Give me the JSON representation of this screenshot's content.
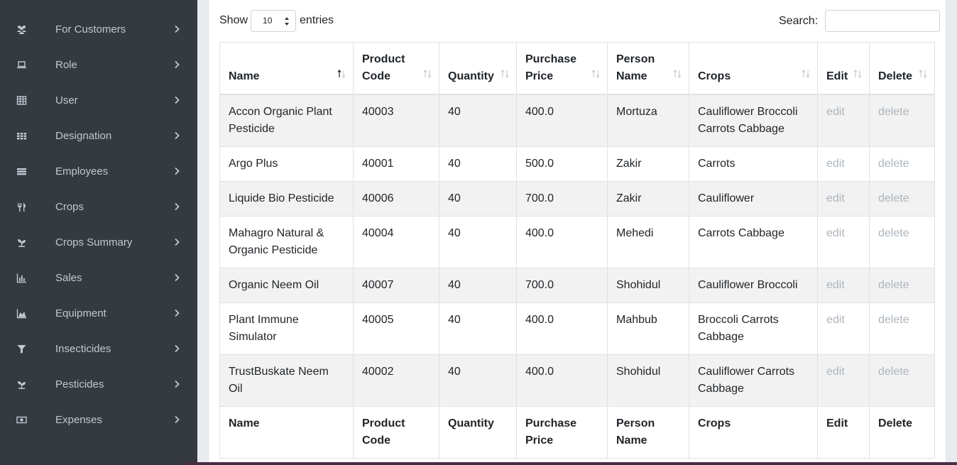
{
  "sidebar": {
    "items": [
      {
        "label": "For Customers",
        "icon": "users-icon"
      },
      {
        "label": "Role",
        "icon": "laptop-icon"
      },
      {
        "label": "User",
        "icon": "table-icon"
      },
      {
        "label": "Designation",
        "icon": "grid-icon"
      },
      {
        "label": "Employees",
        "icon": "list-icon"
      },
      {
        "label": "Crops",
        "icon": "utensils-icon"
      },
      {
        "label": "Crops Summary",
        "icon": "seedling-icon"
      },
      {
        "label": "Sales",
        "icon": "bar-chart-icon"
      },
      {
        "label": "Equipment",
        "icon": "area-chart-icon"
      },
      {
        "label": "Insecticides",
        "icon": "filter-icon"
      },
      {
        "label": "Pesticides",
        "icon": "seedling-icon"
      },
      {
        "label": "Expenses",
        "icon": "money-icon"
      }
    ]
  },
  "controls": {
    "show_label": "Show",
    "length_value": "10",
    "entries_label": "entries",
    "search_label": "Search:",
    "search_value": ""
  },
  "table": {
    "headers": [
      "Name",
      "Product Code",
      "Quantity",
      "Purchase Price",
      "Person Name",
      "Crops",
      "Edit",
      "Delete"
    ],
    "rows": [
      [
        "Accon Organic Plant Pesticide",
        "40003",
        "40",
        "400.0",
        "Mortuza",
        "Cauliflower Broccoli Carrots Cabbage",
        "edit",
        "delete"
      ],
      [
        "Argo Plus",
        "40001",
        "40",
        "500.0",
        "Zakir",
        "Carrots",
        "edit",
        "delete"
      ],
      [
        "Liquide Bio Pesticide",
        "40006",
        "40",
        "700.0",
        "Zakir",
        "Cauliflower",
        "edit",
        "delete"
      ],
      [
        "Mahagro Natural & Organic Pesticide",
        "40004",
        "40",
        "400.0",
        "Mehedi",
        "Carrots Cabbage",
        "edit",
        "delete"
      ],
      [
        "Organic Neem Oil",
        "40007",
        "40",
        "700.0",
        "Shohidul",
        "Cauliflower Broccoli",
        "edit",
        "delete"
      ],
      [
        "Plant Immune Simulator",
        "40005",
        "40",
        "400.0",
        "Mahbub",
        "Broccoli Carrots Cabbage",
        "edit",
        "delete"
      ],
      [
        "TrustBuskate Neem Oil",
        "40002",
        "40",
        "400.0",
        "Shohidul",
        "Cauliflower Carrots Cabbage",
        "edit",
        "delete"
      ]
    ],
    "footers": [
      "Name",
      "Product Code",
      "Quantity",
      "Purchase Price",
      "Person Name",
      "Crops",
      "Edit",
      "Delete"
    ]
  },
  "colors": {
    "sidebar_bg": "#343a40",
    "sidebar_text": "#c2c7d0",
    "stripe": "#f2f2f2",
    "action_link": "#adb5bd"
  }
}
